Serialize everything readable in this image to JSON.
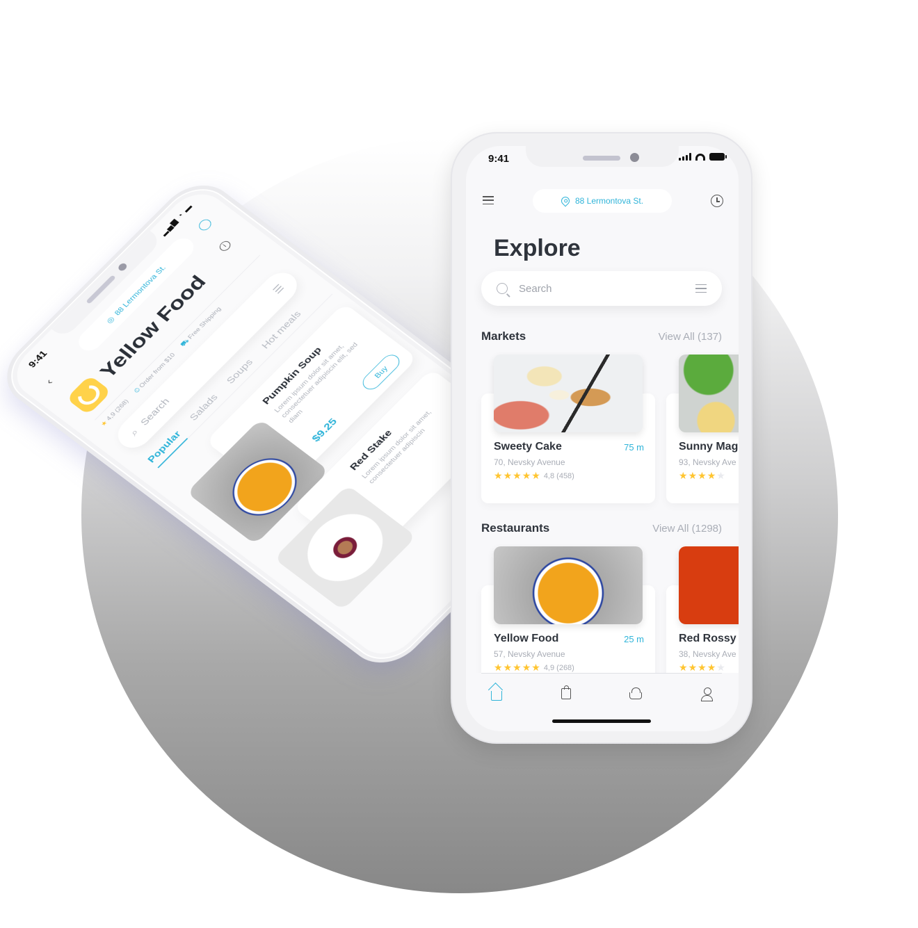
{
  "colors": {
    "accent": "#2fb4d9",
    "star": "#ffc531",
    "logo_yellow": "#ffd24a",
    "title": "#2f343c",
    "muted": "#a9adb6"
  },
  "back_phone": {
    "status": {
      "time": "9:41"
    },
    "address": "88 Lermontova St.",
    "restaurant": {
      "name": "Yellow Food",
      "rating": "4,9 (268)",
      "order_min": "Order from $10",
      "shipping": "Free Shipping"
    },
    "search": {
      "placeholder": "Search"
    },
    "tabs": [
      {
        "label": "Popular",
        "active": true
      },
      {
        "label": "Salads",
        "active": false
      },
      {
        "label": "Soups",
        "active": false
      },
      {
        "label": "Hot meals",
        "active": false
      }
    ],
    "dishes": [
      {
        "name": "Pumpkin Soup",
        "description": "Lorem ipsum dolor sit amet, consectetuer adipiscin elit, sed diam",
        "price": "$9.25",
        "buy_label": "Buy"
      },
      {
        "name": "Red Stake",
        "description": "Lorem ipsum dolor sit amet, consectetuer adipiscin"
      }
    ]
  },
  "front_phone": {
    "status": {
      "time": "9:41"
    },
    "address": "88 Lermontova St.",
    "page_title": "Explore",
    "search": {
      "placeholder": "Search"
    },
    "sections": [
      {
        "title": "Markets",
        "view_all": "View All (137)",
        "items": [
          {
            "name": "Sweety Cake",
            "distance": "75  m",
            "address": "70, Nevsky Avenue",
            "stars": 5,
            "rating": "4,8 (458)"
          },
          {
            "name": "Sunny Mag",
            "address": "93, Nevsky Ave",
            "stars": 4
          }
        ]
      },
      {
        "title": "Restaurants",
        "view_all": "View All (1298)",
        "items": [
          {
            "name": "Yellow Food",
            "distance": "25  m",
            "address": "57, Nevsky Avenue",
            "stars": 5,
            "rating": "4,9 (268)"
          },
          {
            "name": "Red Rossy",
            "address": "38, Nevsky Ave",
            "stars": 4
          }
        ]
      }
    ],
    "tabbar": [
      {
        "icon": "home-icon",
        "active": true
      },
      {
        "icon": "shopping-bag-icon",
        "active": false
      },
      {
        "icon": "basket-icon",
        "active": false
      },
      {
        "icon": "user-icon",
        "active": false
      }
    ]
  }
}
